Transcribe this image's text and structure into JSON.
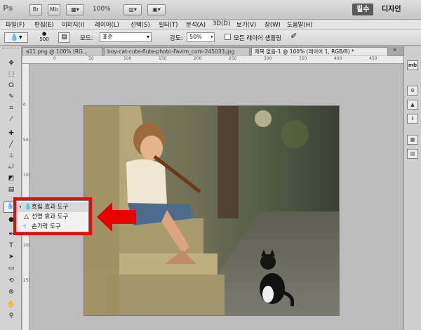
{
  "app": {
    "logo": "Ps",
    "bridge": "Br",
    "minibridge": "Mb",
    "zoom": "100%"
  },
  "workspace": {
    "active": "필수",
    "other": "디자인"
  },
  "menu": [
    "파일(F)",
    "편집(E)",
    "이미지(I)",
    "레이어(L)",
    "선택(S)",
    "필터(T)",
    "분석(A)",
    "3D(D)",
    "보기(V)",
    "창(W)",
    "도움말(H)"
  ],
  "options": {
    "brush_size": "500",
    "mode_label": "모드:",
    "mode_value": "표준",
    "strength_label": "강도:",
    "strength_value": "50%",
    "sample_all_label": "모든 레이어 샘플링"
  },
  "tabs": [
    {
      "label": "a11.png @ 100% (RG..."
    },
    {
      "label": "boy-cat-cute-flute-photo-Favim_com-245033.jpg"
    },
    {
      "label": "제목 없음-1 @ 100% (레이어 1, RGB/8) *"
    }
  ],
  "ruler_top": [
    "0",
    "50",
    "100",
    "150",
    "200",
    "250",
    "300",
    "350",
    "400",
    "450",
    "500"
  ],
  "ruler_left": [
    "0",
    "50",
    "100",
    "150",
    "200",
    "250",
    "300",
    "350"
  ],
  "flyout": {
    "items": [
      {
        "label": "흐림 효과 도구"
      },
      {
        "label": "선명 효과 도구"
      },
      {
        "label": "손가락 도구"
      }
    ]
  },
  "right_panel": [
    "mb",
    "H",
    "A",
    "P"
  ],
  "colors": {
    "highlight": "#ff0000",
    "arrow": "#e60000"
  }
}
